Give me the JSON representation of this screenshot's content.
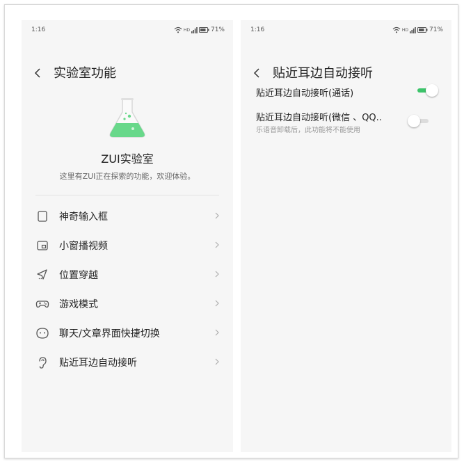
{
  "status_bar": {
    "time": "1:16",
    "network": "HD",
    "battery": "71%"
  },
  "lab_screen": {
    "title": "实验室功能",
    "hero_title": "ZUI实验室",
    "hero_desc": "这里有ZUI正在探索的功能，欢迎体验。",
    "items": [
      {
        "label": "神奇输入框",
        "icon": "text-box-icon"
      },
      {
        "label": "小窗播视频",
        "icon": "picture-in-picture-icon"
      },
      {
        "label": "位置穿越",
        "icon": "location-travel-icon"
      },
      {
        "label": "游戏模式",
        "icon": "gamepad-icon"
      },
      {
        "label": "聊天/文章界面快捷切换",
        "icon": "chat-switch-icon"
      },
      {
        "label": "贴近耳边自动接听",
        "icon": "ear-icon"
      }
    ]
  },
  "answer_screen": {
    "title": "贴近耳边自动接听",
    "settings": [
      {
        "label": "贴近耳边自动接听(通话)",
        "on": true
      },
      {
        "label": "贴近耳边自动接听(微信 、QQ..",
        "sublabel": "乐语音卸载后，此功能将不能使用",
        "on": false
      }
    ]
  },
  "colors": {
    "accent": "#3cc46a",
    "toggle_off_track": "#dcdcdc",
    "background": "#f6f6f6"
  }
}
